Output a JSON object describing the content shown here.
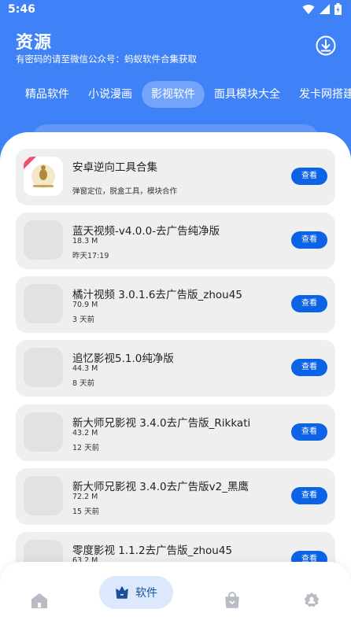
{
  "status_bar": {
    "time": "5:46"
  },
  "header": {
    "title": "资源",
    "subtitle": "有密码的请至微信公众号：蚂蚁软件合集获取"
  },
  "tabs": [
    {
      "label": "精品软件",
      "active": false
    },
    {
      "label": "小说漫画",
      "active": false
    },
    {
      "label": "影视软件",
      "active": true
    },
    {
      "label": "面具模块大全",
      "active": false
    },
    {
      "label": "发卡网搭建",
      "active": false
    }
  ],
  "items": [
    {
      "title": "安卓逆向工具合集",
      "description": "弹窗定位，脱盒工具，模块合作",
      "button": "查看",
      "icon": "ant-logo"
    },
    {
      "title": "蓝天视频-v4.0.0-去广告纯净版",
      "size": "18.3 M",
      "time": "昨天17:19",
      "button": "查看"
    },
    {
      "title": "橘汁视频 3.0.1.6去广告版_zhou45",
      "size": "70.9 M",
      "time": "3 天前",
      "button": "查看"
    },
    {
      "title": "追忆影视5.1.0纯净版",
      "size": "44.3 M",
      "time": "8 天前",
      "button": "查看"
    },
    {
      "title": "新大师兄影视 3.4.0去广告版_Rikkati",
      "size": "43.2 M",
      "time": "12 天前",
      "button": "查看"
    },
    {
      "title": "新大师兄影视 3.4.0去广告版v2_黑鹰",
      "size": "72.2 M",
      "time": "15 天前",
      "button": "查看"
    },
    {
      "title": "零度影视 1.1.2去广告版_zhou45",
      "size": "63.2 M",
      "time": "",
      "button": "查看"
    }
  ],
  "bottom_nav": {
    "items": [
      {
        "icon": "home-icon",
        "label": ""
      },
      {
        "icon": "crown-icon",
        "label": "软件",
        "active": true
      },
      {
        "icon": "bag-icon",
        "label": ""
      },
      {
        "icon": "gear-person-icon",
        "label": ""
      }
    ]
  },
  "colors": {
    "primary": "#3f82f7",
    "button": "#0d63e6",
    "card": "#efefef"
  }
}
